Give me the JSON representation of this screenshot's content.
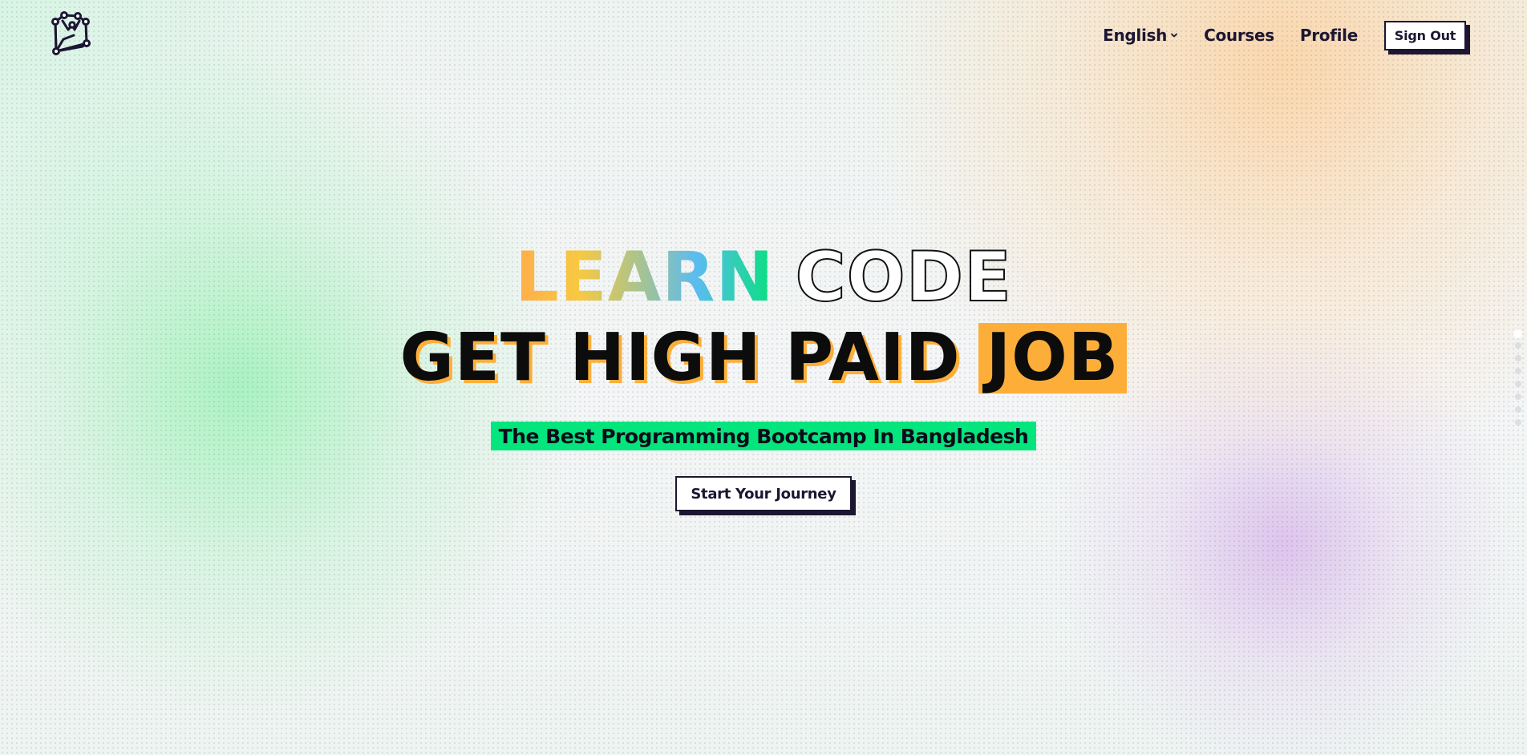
{
  "brand": {
    "logo_icon": "owl-node-logo-icon"
  },
  "nav": {
    "language_label": "English",
    "language_icon": "chevron-down-icon",
    "courses_label": "Courses",
    "profile_label": "Profile",
    "signout_label": "Sign Out"
  },
  "hero": {
    "learn_word": "LEARN",
    "code_word": "CODE",
    "headline_main": "GET HIGH PAID",
    "headline_highlight": "JOB",
    "tagline": "The Best Programming Bootcamp In Bangladesh",
    "cta_label": "Start Your Journey"
  },
  "pager": {
    "active_index": 0,
    "count": 8
  },
  "colors": {
    "ink": "#1c1633",
    "highlight_orange": "#fdae39",
    "highlight_green": "#04e57e",
    "learn_gradient": [
      "#ffad4a",
      "#f7c942",
      "#a9c48e",
      "#5bbcf0",
      "#08e07d"
    ]
  }
}
